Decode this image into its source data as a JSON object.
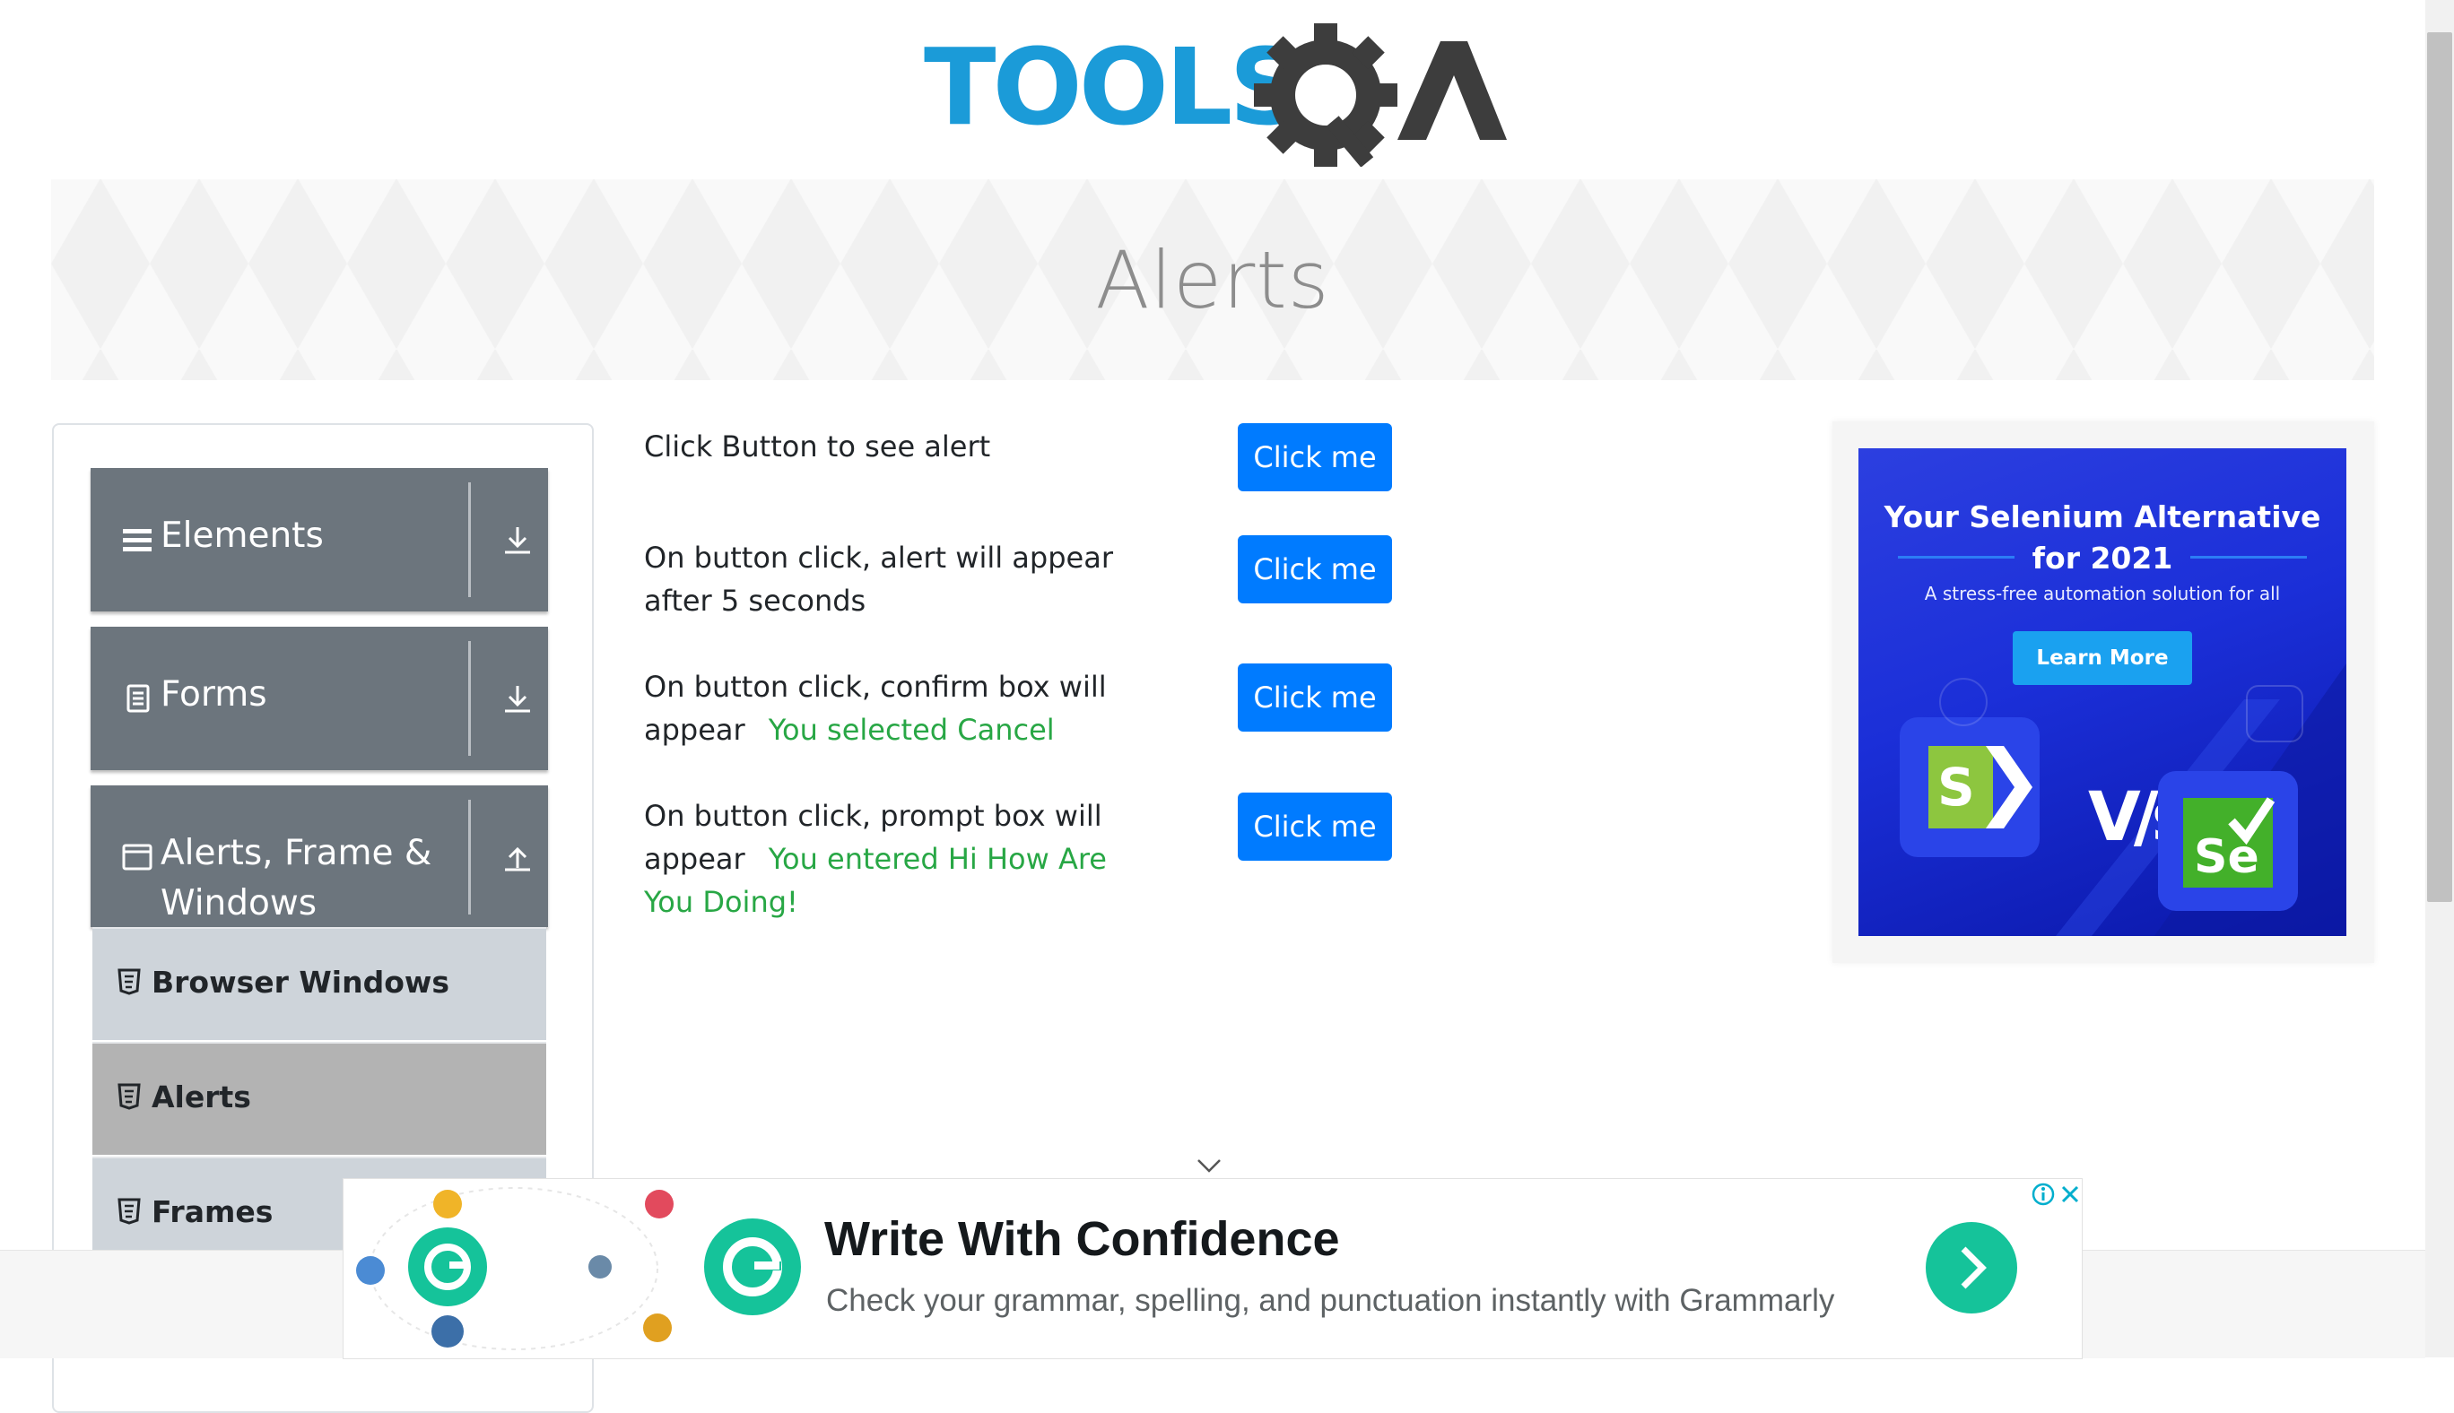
{
  "brand": {
    "logo_text": "TOOLSQA"
  },
  "page": {
    "title": "Alerts"
  },
  "sidebar": {
    "groups": [
      {
        "label": "Elements",
        "icon": "hamburger-icon",
        "arrow": "download-icon"
      },
      {
        "label": "Forms",
        "icon": "document-icon",
        "arrow": "download-icon"
      },
      {
        "label": "Alerts, Frame & Windows",
        "icon": "window-icon",
        "arrow": "upload-icon"
      }
    ],
    "items": [
      {
        "label": "Browser Windows",
        "icon": "html5-icon",
        "active": false
      },
      {
        "label": "Alerts",
        "icon": "html5-icon",
        "active": true
      },
      {
        "label": "Frames",
        "icon": "html5-icon",
        "active": false
      }
    ]
  },
  "alerts": {
    "rows": [
      {
        "text": "Click Button to see alert",
        "result": "",
        "button": "Click me"
      },
      {
        "text": "On button click, alert will appear after 5 seconds",
        "result": "",
        "button": "Click me"
      },
      {
        "text": "On button click, confirm box will appear",
        "result": "You selected Cancel",
        "button": "Click me"
      },
      {
        "text": "On button click, prompt box will appear",
        "result": "You entered Hi How Are You Doing!",
        "button": "Click me"
      }
    ]
  },
  "right_ad": {
    "title_line1": "Your Selenium Alternative",
    "title_line2": "for 2021",
    "subtitle": "A stress-free automation solution for all",
    "cta": "Learn More",
    "vs_text": "V/s",
    "left_logo_letter": "S",
    "right_logo_letter": "Se"
  },
  "bottom_ad": {
    "title": "Write With Confidence",
    "subtitle": "Check your grammar, spelling, and punctuation instantly with Grammarly",
    "brand_letter": "G"
  },
  "colors": {
    "primary_button": "#007bff",
    "sidebar_group": "#6c757d",
    "sidebar_item": "#ced4da",
    "sidebar_item_active": "#b3b3b3",
    "result_text": "#28a745",
    "logo_blue": "#1b9bd8",
    "logo_dark": "#3d3d3d",
    "grammarly_green": "#15c39a"
  }
}
